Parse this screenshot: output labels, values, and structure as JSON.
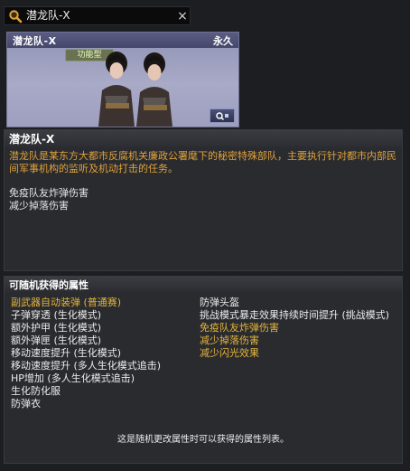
{
  "search": {
    "value": "潜龙队-X",
    "clear_label": "×"
  },
  "card": {
    "title": "潜龙队-X",
    "duration": "永久",
    "badge": "功能型"
  },
  "info": {
    "title": "潜龙队-X",
    "description": "潜龙队是某东方大都市反腐机关廉政公署麾下的秘密特殊部队，主要执行针对都市内部民间军事机构的监听及机动打击的任务。",
    "effects": [
      "免疫队友炸弹伤害",
      "减少掉落伤害"
    ]
  },
  "attributes": {
    "title": "可随机获得的属性",
    "left": [
      {
        "text": "副武器自动装弹 (普通赛)",
        "highlight": true
      },
      {
        "text": "子弹穿透 (生化模式)",
        "highlight": false
      },
      {
        "text": "额外护甲 (生化模式)",
        "highlight": false
      },
      {
        "text": "额外弹匣 (生化模式)",
        "highlight": false
      },
      {
        "text": "移动速度提升 (生化模式)",
        "highlight": false
      },
      {
        "text": "移动速度提升 (多人生化模式追击)",
        "highlight": false
      },
      {
        "text": "HP增加 (多人生化模式追击)",
        "highlight": false
      },
      {
        "text": "生化防化服",
        "highlight": false
      },
      {
        "text": "防弹衣",
        "highlight": false
      }
    ],
    "right": [
      {
        "text": "防弹头盔",
        "highlight": false
      },
      {
        "text": "挑战模式暴走效果持续时间提升 (挑战模式)",
        "highlight": false
      },
      {
        "text": "免疫队友炸弹伤害",
        "highlight": true
      },
      {
        "text": "减少掉落伤害",
        "highlight": true
      },
      {
        "text": "减少闪光效果",
        "highlight": true
      }
    ],
    "footer": "这是随机更改属性时可以获得的属性列表。"
  },
  "colors": {
    "highlight": "#e4b53c",
    "description": "#e0a23a",
    "card_bg": "#a9aac7"
  }
}
